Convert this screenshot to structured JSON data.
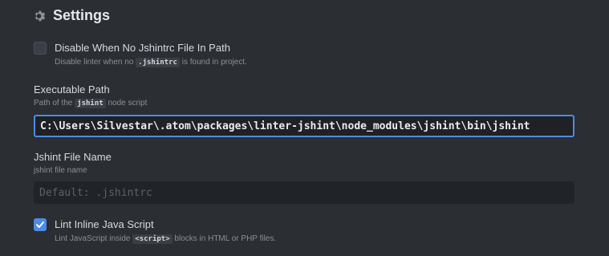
{
  "header": {
    "title": "Settings",
    "icon": "gear-icon"
  },
  "disable_no_jshintrc": {
    "label": "Disable When No Jshintrc File In Path",
    "desc_before": "Disable linter when no",
    "desc_code": ".jshintrc",
    "desc_after": "is found in project.",
    "checked": false
  },
  "executable_path": {
    "label": "Executable Path",
    "desc_before": "Path of the",
    "desc_code": "jshint",
    "desc_after": "node script",
    "value": "C:\\Users\\Silvestar\\.atom\\packages\\linter-jshint\\node_modules\\jshint\\bin\\jshint"
  },
  "jshint_file_name": {
    "label": "Jshint File Name",
    "desc": "jshint file name",
    "placeholder": "Default: .jshintrc",
    "value": ""
  },
  "lint_inline_js": {
    "label": "Lint Inline Java Script",
    "desc_before": "Lint JavaScript inside",
    "desc_code": "<script>",
    "desc_after": "blocks in HTML or PHP files.",
    "checked": true
  },
  "colors": {
    "accent": "#4d8be6",
    "background": "#2b2e33"
  }
}
